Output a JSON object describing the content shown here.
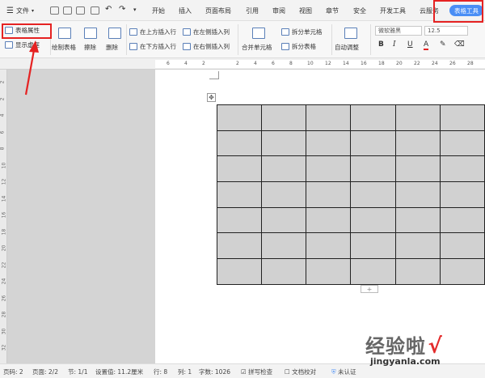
{
  "topbar": {
    "file_menu": "文件",
    "tabs": [
      "开始",
      "插入",
      "页面布局",
      "引用",
      "审阅",
      "视图",
      "章节",
      "安全",
      "开发工具",
      "云服务"
    ],
    "active_tab": "表格工具"
  },
  "ribbon": {
    "table_props": "表格属性",
    "show_gridlines": "显示虚框",
    "draw_table": "绘制表格",
    "erase": "擦除",
    "delete": "删除",
    "insert_above": "在上方插入行",
    "insert_below": "在下方插入行",
    "insert_left": "在左侧插入列",
    "insert_right": "在右侧插入列",
    "merge_cells": "合并单元格",
    "split_cells": "拆分单元格",
    "split_table": "拆分表格",
    "auto_fit": "自动调整",
    "font_name": "微软雅黑",
    "font_size": "12.5",
    "bold": "B",
    "italic": "I",
    "underline": "U",
    "font_color": "A"
  },
  "ruler": {
    "h_marks": [
      "6",
      "4",
      "2",
      "2",
      "4",
      "6",
      "8",
      "10",
      "12",
      "14",
      "16",
      "18",
      "20",
      "22",
      "24",
      "26",
      "28",
      "30",
      "32",
      "34"
    ],
    "v_marks": [
      "2",
      "2",
      "4",
      "6",
      "8",
      "10",
      "12",
      "14",
      "16",
      "18",
      "20",
      "22",
      "24",
      "26",
      "28",
      "30",
      "32"
    ]
  },
  "table": {
    "rows": 7,
    "cols": 6,
    "fill": "#d1d1d1"
  },
  "status": {
    "page_no": "页码: 2",
    "page": "页面: 2/2",
    "section": "节: 1/1",
    "setting": "设置值: 11.2厘米",
    "row": "行: 8",
    "col": "列: 1",
    "words": "字数: 1026",
    "spell": "拼写检查",
    "proof": "文档校对",
    "auth": "未认证"
  },
  "watermark": {
    "text": "经验啦",
    "check": "√",
    "url": "jingyanla.com"
  },
  "colors": {
    "accent": "#4a8ef5",
    "highlight": "#e52222",
    "cell": "#d1d1d1"
  }
}
